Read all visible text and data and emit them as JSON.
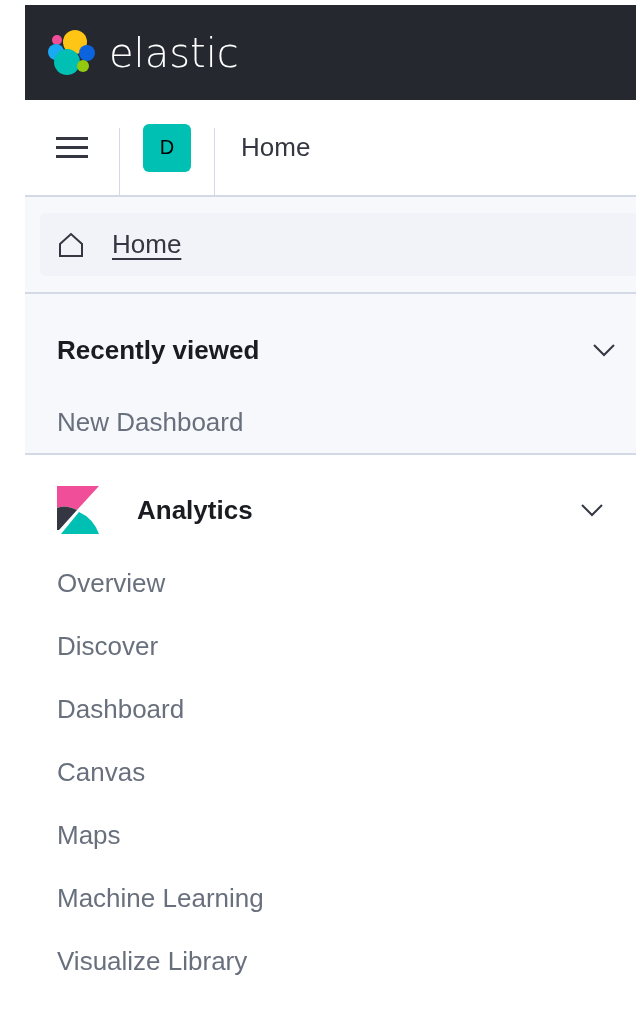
{
  "header": {
    "brand": "elastic"
  },
  "topbar": {
    "space_initial": "D",
    "breadcrumb": "Home"
  },
  "home_link": {
    "label": "Home"
  },
  "recently_viewed": {
    "title": "Recently viewed",
    "expanded": true,
    "items": [
      "New Dashboard"
    ]
  },
  "analytics": {
    "title": "Analytics",
    "expanded": true,
    "items": [
      "Overview",
      "Discover",
      "Dashboard",
      "Canvas",
      "Maps",
      "Machine Learning",
      "Visualize Library"
    ]
  }
}
